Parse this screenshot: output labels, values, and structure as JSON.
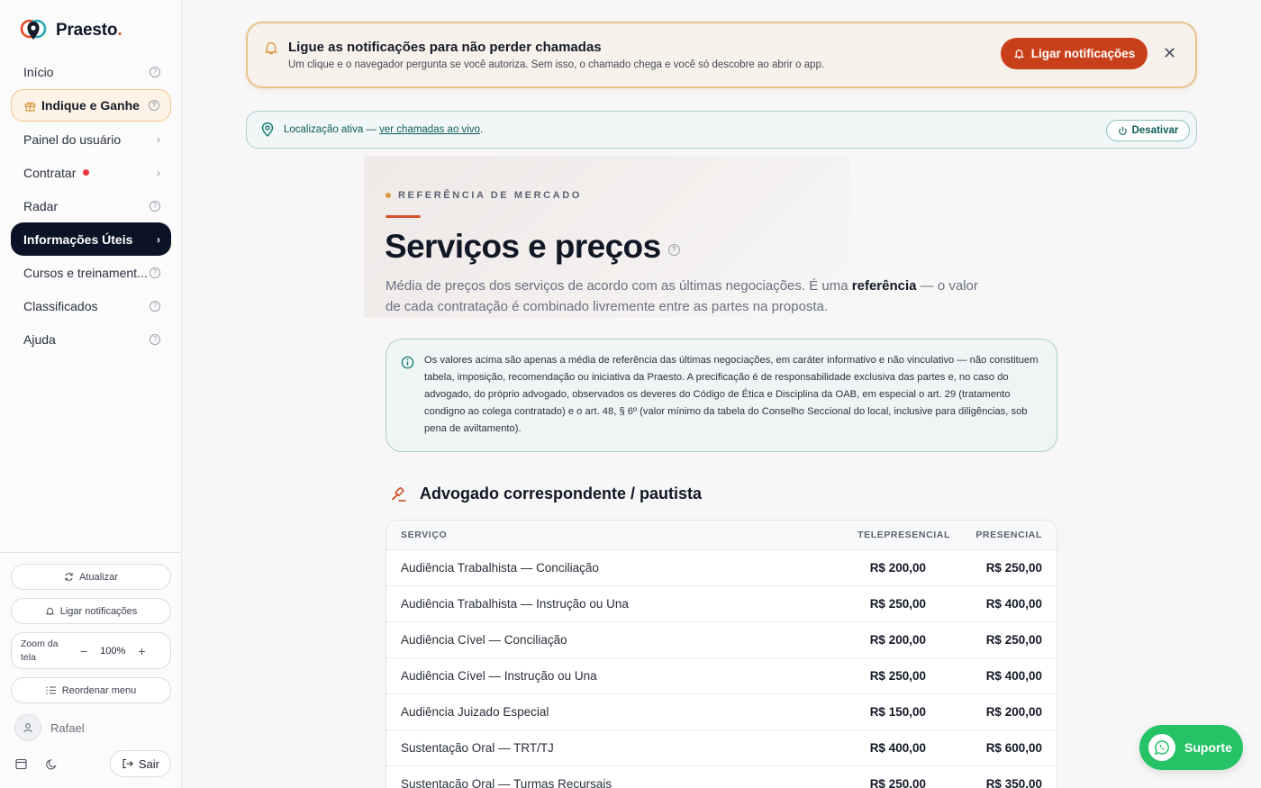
{
  "brand": {
    "name": "Praesto",
    "dot": "."
  },
  "sidebar": {
    "items": [
      {
        "label": "Início"
      },
      {
        "label": "Indique e Ganhe"
      },
      {
        "label": "Painel do usuário"
      },
      {
        "label": "Contratar"
      },
      {
        "label": "Radar"
      },
      {
        "label": "Informações Úteis"
      },
      {
        "label": "Cursos e treinament..."
      },
      {
        "label": "Classificados"
      },
      {
        "label": "Ajuda"
      }
    ],
    "refresh_label": "Atualizar",
    "notif_label": "Ligar notificações",
    "zoom_label": "Zoom da tela",
    "zoom_minus": "−",
    "zoom_value": "100%",
    "zoom_plus": "+",
    "reorder_label": "Reordenar menu",
    "user_name": "Rafael",
    "logout_label": "Sair"
  },
  "notif_banner": {
    "title": "Ligue as notificações para não perder chamadas",
    "desc": "Um clique e o navegador pergunta se você autoriza. Sem isso, o chamado chega e você só descobre ao abrir o app.",
    "button": "Ligar notificações",
    "close": "✕"
  },
  "location": {
    "text": "Localização ativa — ",
    "link": "ver chamadas ao vivo",
    "suffix": ".",
    "deactivate": "Desativar"
  },
  "hero": {
    "eyebrow": "REFERÊNCIA DE MERCADO",
    "title": "Serviços e preços",
    "sub_a": "Média de preços dos serviços de acordo com as últimas negociações. É uma ",
    "sub_bold": "referência",
    "sub_b": " — o valor de cada contratação é combinado livremente entre as partes na proposta."
  },
  "disclaimer": "Os valores acima são apenas a média de referência das últimas negociações, em caráter informativo e não vinculativo — não constituem tabela, imposição, recomendação ou iniciativa da Praesto. A precificação é de responsabilidade exclusiva das partes e, no caso do advogado, do próprio advogado, observados os deveres do Código de Ética e Disciplina da OAB, em especial o art. 29 (tratamento condigno ao colega contratado) e o art. 48, § 6º (valor mínimo da tabela do Conselho Seccional do local, inclusive para diligências, sob pena de aviltamento).",
  "section": {
    "title": "Advogado correspondente / pautista"
  },
  "table": {
    "headers": {
      "service": "SERVIÇO",
      "tele": "TELEPRESENCIAL",
      "pres": "PRESENCIAL"
    },
    "rows": [
      {
        "service": "Audiência Trabalhista — Conciliação",
        "tele": "R$ 200,00",
        "pres": "R$ 250,00"
      },
      {
        "service": "Audiência Trabalhista — Instrução ou Una",
        "tele": "R$ 250,00",
        "pres": "R$ 400,00"
      },
      {
        "service": "Audiência Cível — Conciliação",
        "tele": "R$ 200,00",
        "pres": "R$ 250,00"
      },
      {
        "service": "Audiência Cível — Instrução ou Una",
        "tele": "R$ 250,00",
        "pres": "R$ 400,00"
      },
      {
        "service": "Audiência Juizado Especial",
        "tele": "R$ 150,00",
        "pres": "R$ 200,00"
      },
      {
        "service": "Sustentação Oral — TRT/TJ",
        "tele": "R$ 400,00",
        "pres": "R$ 600,00"
      },
      {
        "service": "Sustentação Oral — Turmas Recursais",
        "tele": "R$ 250,00",
        "pres": "R$ 350,00"
      }
    ]
  },
  "support": {
    "label": "Suporte"
  },
  "colors": {
    "accent": "#c8401a",
    "active_nav": "#0b1426",
    "teal": "#0f5e5a",
    "whatsapp": "#25c366"
  }
}
